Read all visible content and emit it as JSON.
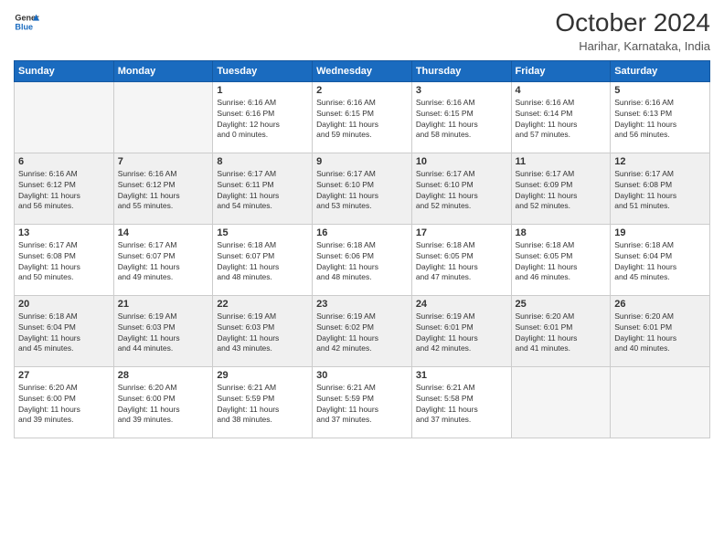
{
  "header": {
    "logo": {
      "line1": "General",
      "line2": "Blue"
    },
    "title": "October 2024",
    "subtitle": "Harihar, Karnataka, India"
  },
  "weekdays": [
    "Sunday",
    "Monday",
    "Tuesday",
    "Wednesday",
    "Thursday",
    "Friday",
    "Saturday"
  ],
  "weeks": [
    [
      {
        "day": "",
        "info": ""
      },
      {
        "day": "",
        "info": ""
      },
      {
        "day": "1",
        "info": "Sunrise: 6:16 AM\nSunset: 6:16 PM\nDaylight: 12 hours\nand 0 minutes."
      },
      {
        "day": "2",
        "info": "Sunrise: 6:16 AM\nSunset: 6:15 PM\nDaylight: 11 hours\nand 59 minutes."
      },
      {
        "day": "3",
        "info": "Sunrise: 6:16 AM\nSunset: 6:15 PM\nDaylight: 11 hours\nand 58 minutes."
      },
      {
        "day": "4",
        "info": "Sunrise: 6:16 AM\nSunset: 6:14 PM\nDaylight: 11 hours\nand 57 minutes."
      },
      {
        "day": "5",
        "info": "Sunrise: 6:16 AM\nSunset: 6:13 PM\nDaylight: 11 hours\nand 56 minutes."
      }
    ],
    [
      {
        "day": "6",
        "info": "Sunrise: 6:16 AM\nSunset: 6:12 PM\nDaylight: 11 hours\nand 56 minutes."
      },
      {
        "day": "7",
        "info": "Sunrise: 6:16 AM\nSunset: 6:12 PM\nDaylight: 11 hours\nand 55 minutes."
      },
      {
        "day": "8",
        "info": "Sunrise: 6:17 AM\nSunset: 6:11 PM\nDaylight: 11 hours\nand 54 minutes."
      },
      {
        "day": "9",
        "info": "Sunrise: 6:17 AM\nSunset: 6:10 PM\nDaylight: 11 hours\nand 53 minutes."
      },
      {
        "day": "10",
        "info": "Sunrise: 6:17 AM\nSunset: 6:10 PM\nDaylight: 11 hours\nand 52 minutes."
      },
      {
        "day": "11",
        "info": "Sunrise: 6:17 AM\nSunset: 6:09 PM\nDaylight: 11 hours\nand 52 minutes."
      },
      {
        "day": "12",
        "info": "Sunrise: 6:17 AM\nSunset: 6:08 PM\nDaylight: 11 hours\nand 51 minutes."
      }
    ],
    [
      {
        "day": "13",
        "info": "Sunrise: 6:17 AM\nSunset: 6:08 PM\nDaylight: 11 hours\nand 50 minutes."
      },
      {
        "day": "14",
        "info": "Sunrise: 6:17 AM\nSunset: 6:07 PM\nDaylight: 11 hours\nand 49 minutes."
      },
      {
        "day": "15",
        "info": "Sunrise: 6:18 AM\nSunset: 6:07 PM\nDaylight: 11 hours\nand 48 minutes."
      },
      {
        "day": "16",
        "info": "Sunrise: 6:18 AM\nSunset: 6:06 PM\nDaylight: 11 hours\nand 48 minutes."
      },
      {
        "day": "17",
        "info": "Sunrise: 6:18 AM\nSunset: 6:05 PM\nDaylight: 11 hours\nand 47 minutes."
      },
      {
        "day": "18",
        "info": "Sunrise: 6:18 AM\nSunset: 6:05 PM\nDaylight: 11 hours\nand 46 minutes."
      },
      {
        "day": "19",
        "info": "Sunrise: 6:18 AM\nSunset: 6:04 PM\nDaylight: 11 hours\nand 45 minutes."
      }
    ],
    [
      {
        "day": "20",
        "info": "Sunrise: 6:18 AM\nSunset: 6:04 PM\nDaylight: 11 hours\nand 45 minutes."
      },
      {
        "day": "21",
        "info": "Sunrise: 6:19 AM\nSunset: 6:03 PM\nDaylight: 11 hours\nand 44 minutes."
      },
      {
        "day": "22",
        "info": "Sunrise: 6:19 AM\nSunset: 6:03 PM\nDaylight: 11 hours\nand 43 minutes."
      },
      {
        "day": "23",
        "info": "Sunrise: 6:19 AM\nSunset: 6:02 PM\nDaylight: 11 hours\nand 42 minutes."
      },
      {
        "day": "24",
        "info": "Sunrise: 6:19 AM\nSunset: 6:01 PM\nDaylight: 11 hours\nand 42 minutes."
      },
      {
        "day": "25",
        "info": "Sunrise: 6:20 AM\nSunset: 6:01 PM\nDaylight: 11 hours\nand 41 minutes."
      },
      {
        "day": "26",
        "info": "Sunrise: 6:20 AM\nSunset: 6:01 PM\nDaylight: 11 hours\nand 40 minutes."
      }
    ],
    [
      {
        "day": "27",
        "info": "Sunrise: 6:20 AM\nSunset: 6:00 PM\nDaylight: 11 hours\nand 39 minutes."
      },
      {
        "day": "28",
        "info": "Sunrise: 6:20 AM\nSunset: 6:00 PM\nDaylight: 11 hours\nand 39 minutes."
      },
      {
        "day": "29",
        "info": "Sunrise: 6:21 AM\nSunset: 5:59 PM\nDaylight: 11 hours\nand 38 minutes."
      },
      {
        "day": "30",
        "info": "Sunrise: 6:21 AM\nSunset: 5:59 PM\nDaylight: 11 hours\nand 37 minutes."
      },
      {
        "day": "31",
        "info": "Sunrise: 6:21 AM\nSunset: 5:58 PM\nDaylight: 11 hours\nand 37 minutes."
      },
      {
        "day": "",
        "info": ""
      },
      {
        "day": "",
        "info": ""
      }
    ]
  ]
}
